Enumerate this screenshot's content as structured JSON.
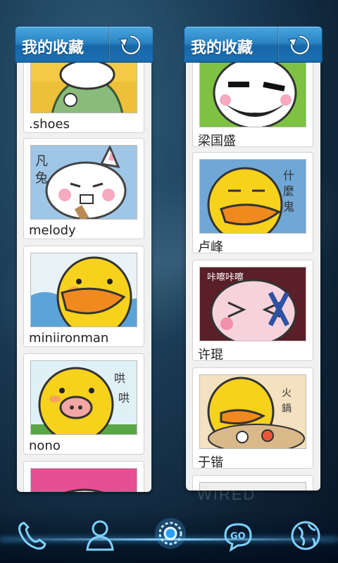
{
  "widgets": [
    {
      "title": "我的收藏",
      "refresh_icon": "refresh-icon",
      "items": [
        {
          "label": ".shoes"
        },
        {
          "label": "melody"
        },
        {
          "label": "miniironman"
        },
        {
          "label": "nono"
        },
        {
          "label": ""
        }
      ]
    },
    {
      "title": "我的收藏",
      "refresh_icon": "refresh-icon",
      "items": [
        {
          "label": "梁国盛"
        },
        {
          "label": "卢峰"
        },
        {
          "label": "许琨"
        },
        {
          "label": "于锴"
        },
        {
          "label": ""
        }
      ]
    }
  ],
  "dock": {
    "icons": [
      "phone-icon",
      "contacts-icon",
      "app-drawer-icon",
      "go-sms-icon",
      "browser-globe-icon"
    ]
  },
  "colors": {
    "header_blue": "#2c85c4",
    "dock_glow": "#4ab6ff",
    "duck_yellow": "#f7d21c",
    "beak_orange": "#f08a1e"
  }
}
